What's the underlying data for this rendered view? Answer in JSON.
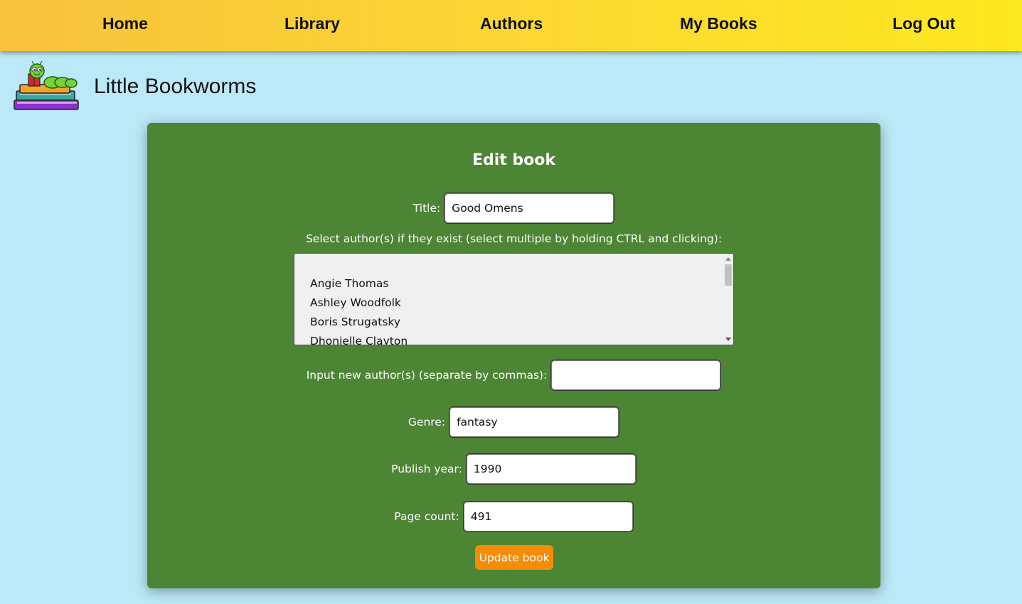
{
  "nav": {
    "home": "Home",
    "library": "Library",
    "authors": "Authors",
    "my_books": "My Books",
    "log_out": "Log Out"
  },
  "brand": {
    "title": "Little Bookworms",
    "logo_icon": "bookworm-on-books-icon"
  },
  "form": {
    "heading": "Edit book",
    "title_label": "Title:",
    "title_value": "Good Omens",
    "authors_label": "Select author(s) if they exist (select multiple by holding CTRL and clicking):",
    "authors_options": [
      "Angie Thomas",
      "Ashley Woodfolk",
      "Boris Strugatsky",
      "Dhonielle Clayton"
    ],
    "new_author_label": "Input new author(s) (separate by commas):",
    "new_author_value": "",
    "genre_label": "Genre:",
    "genre_value": "fantasy",
    "year_label": "Publish year:",
    "year_value": "1990",
    "pages_label": "Page count:",
    "pages_value": "491",
    "submit_label": "Update book"
  },
  "colors": {
    "page_background": "#bce9f7",
    "nav_gradient_start": "#f8c23c",
    "nav_gradient_end": "#fde91f",
    "panel_green": "#4c8534",
    "button_orange": "#f68b05"
  }
}
